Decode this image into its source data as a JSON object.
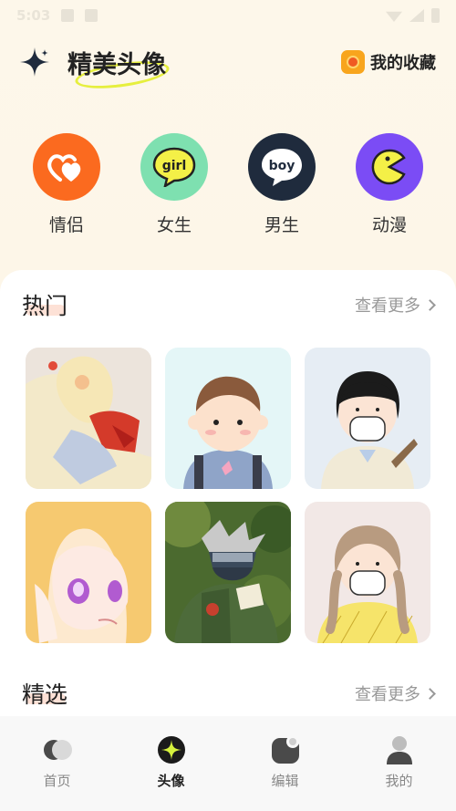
{
  "status_bar": {
    "time": "5:03"
  },
  "header": {
    "title": "精美头像",
    "favorites_label": "我的收藏"
  },
  "categories": [
    {
      "label": "情侣",
      "color": "#fb6a1f",
      "icon": "heart-icon"
    },
    {
      "label": "女生",
      "color": "#7ee0b0",
      "icon": "girl-badge-icon",
      "badge_text": "girl"
    },
    {
      "label": "男生",
      "color": "#1f2b3d",
      "icon": "boy-badge-icon",
      "badge_text": "boy"
    },
    {
      "label": "动漫",
      "color": "#7b4cf5",
      "icon": "pacman-icon"
    }
  ],
  "sections": [
    {
      "title": "热门",
      "more_label": "查看更多"
    },
    {
      "title": "精选",
      "more_label": "查看更多"
    }
  ],
  "hot_thumbnails": [
    {
      "subject": "anime-sailor-girl-avatar"
    },
    {
      "subject": "cartoon-boy-avatar"
    },
    {
      "subject": "masked-girl-avatar"
    },
    {
      "subject": "anime-blonde-girl-avatar"
    },
    {
      "subject": "ninja-kakashi-avatar"
    },
    {
      "subject": "masked-braids-girl-avatar"
    }
  ],
  "bottom_nav": [
    {
      "label": "首页",
      "icon": "home-icon",
      "active": false
    },
    {
      "label": "头像",
      "icon": "avatar-sparkle-icon",
      "active": true
    },
    {
      "label": "编辑",
      "icon": "edit-icon",
      "active": false
    },
    {
      "label": "我的",
      "icon": "profile-icon",
      "active": false
    }
  ],
  "colors": {
    "accent_yellow": "#e6ef3e",
    "header_bg": "#fdf7ea",
    "nav_bg": "#f8f8f8"
  }
}
